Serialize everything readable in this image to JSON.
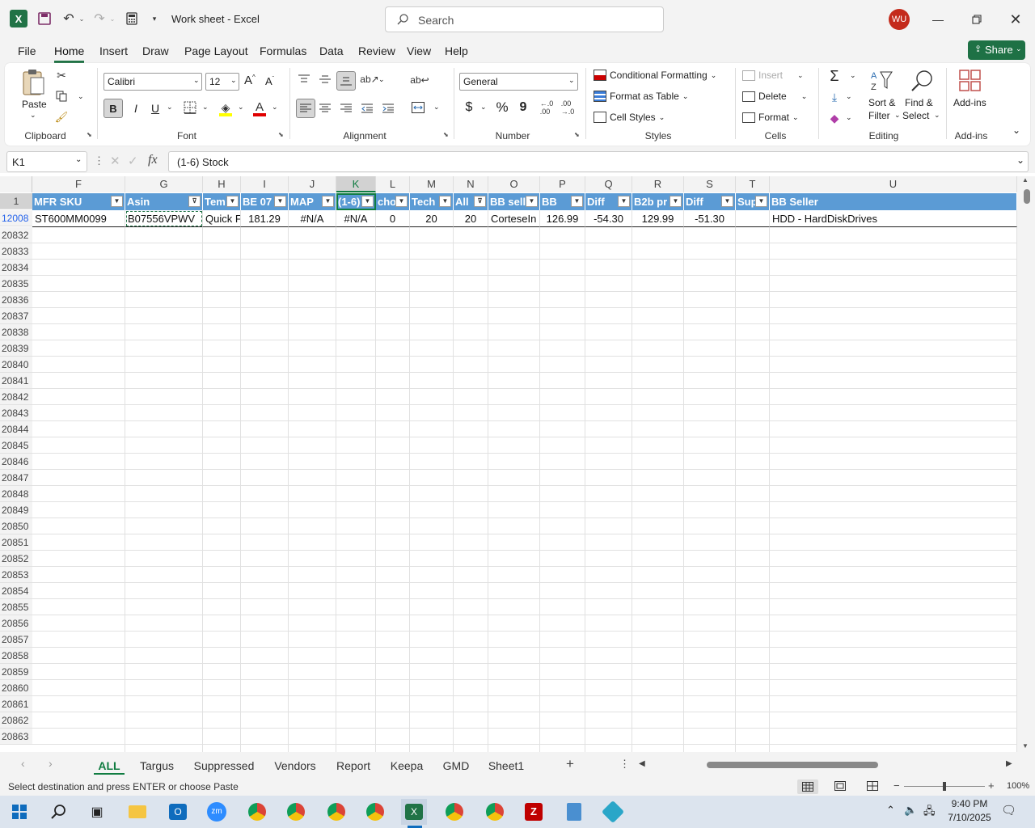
{
  "titlebar": {
    "title": "Work sheet  -  Excel",
    "search_placeholder": "Search",
    "avatar": "WU"
  },
  "ribbon_tabs": [
    "File",
    "Home",
    "Insert",
    "Draw",
    "Page Layout",
    "Formulas",
    "Data",
    "Review",
    "View",
    "Help"
  ],
  "share_label": "Share",
  "clipboard": {
    "paste": "Paste",
    "label": "Clipboard"
  },
  "font": {
    "name": "Calibri",
    "size": "12",
    "label": "Font",
    "bold": "B",
    "italic": "I",
    "underline": "U"
  },
  "alignment": {
    "label": "Alignment"
  },
  "number": {
    "format": "General",
    "label": "Number",
    "currency": "$",
    "percent": "%",
    "comma": "9"
  },
  "styles": {
    "conditional": "Conditional Formatting",
    "format_table": "Format as Table",
    "cell_styles": "Cell Styles",
    "label": "Styles"
  },
  "cells": {
    "insert": "Insert",
    "delete": "Delete",
    "format": "Format",
    "label": "Cells"
  },
  "editing": {
    "sort": "Sort &",
    "filter": "Filter",
    "find": "Find &",
    "select": "Select",
    "label": "Editing"
  },
  "addins": {
    "label_btn": "Add-ins",
    "label": "Add-ins"
  },
  "formula_bar": {
    "name_box": "K1",
    "content": "(1-6) Stock",
    "fx": "fx"
  },
  "columns": [
    {
      "letter": "F",
      "header": "MFR SKU",
      "value": "ST600MM0099"
    },
    {
      "letter": "G",
      "header": "Asin",
      "value": "B07556VPWV"
    },
    {
      "letter": "H",
      "header": "Tem",
      "value": "Quick F"
    },
    {
      "letter": "I",
      "header": "BE 07",
      "value": "181.29"
    },
    {
      "letter": "J",
      "header": "MAP",
      "value": "#N/A"
    },
    {
      "letter": "K",
      "header": "(1-6)",
      "value": "#N/A"
    },
    {
      "letter": "L",
      "header": "cho",
      "value": "0"
    },
    {
      "letter": "M",
      "header": "Tech",
      "value": "20"
    },
    {
      "letter": "N",
      "header": "All",
      "value": "20"
    },
    {
      "letter": "O",
      "header": "BB sell",
      "value": "CorteseIn"
    },
    {
      "letter": "P",
      "header": "BB",
      "value": "126.99"
    },
    {
      "letter": "Q",
      "header": "Diff",
      "value": "-54.30"
    },
    {
      "letter": "R",
      "header": "B2b pr",
      "value": "129.99"
    },
    {
      "letter": "S",
      "header": "Diff",
      "value": "-51.30"
    },
    {
      "letter": "T",
      "header": "Sup",
      "value": ""
    },
    {
      "letter": "U",
      "header": "BB Seller",
      "value": "HDD - HardDiskDrives"
    }
  ],
  "row_numbers": [
    "1",
    "12008",
    "20832",
    "20833",
    "20834",
    "20835",
    "20836",
    "20837",
    "20838",
    "20839",
    "20840",
    "20841",
    "20842",
    "20843",
    "20844",
    "20845",
    "20846",
    "20847",
    "20848",
    "20849",
    "20850",
    "20851",
    "20852",
    "20853",
    "20854",
    "20855",
    "20856",
    "20857",
    "20858",
    "20859",
    "20860",
    "20861",
    "20862",
    "20863"
  ],
  "sheet_tabs": [
    "ALL",
    "Targus",
    "Suppressed",
    "Vendors",
    "Report",
    "Keepa",
    "GMD",
    "Sheet1"
  ],
  "status": {
    "message": "Select destination and press ENTER or choose Paste",
    "zoom": "100%"
  },
  "clock": {
    "time": "9:40 PM",
    "date": "7/10/2025"
  },
  "colors": {
    "excel_green": "#217346",
    "header_blue": "#5b9bd5",
    "avatar_red": "#c42b1c",
    "share_green": "#1e7145"
  }
}
